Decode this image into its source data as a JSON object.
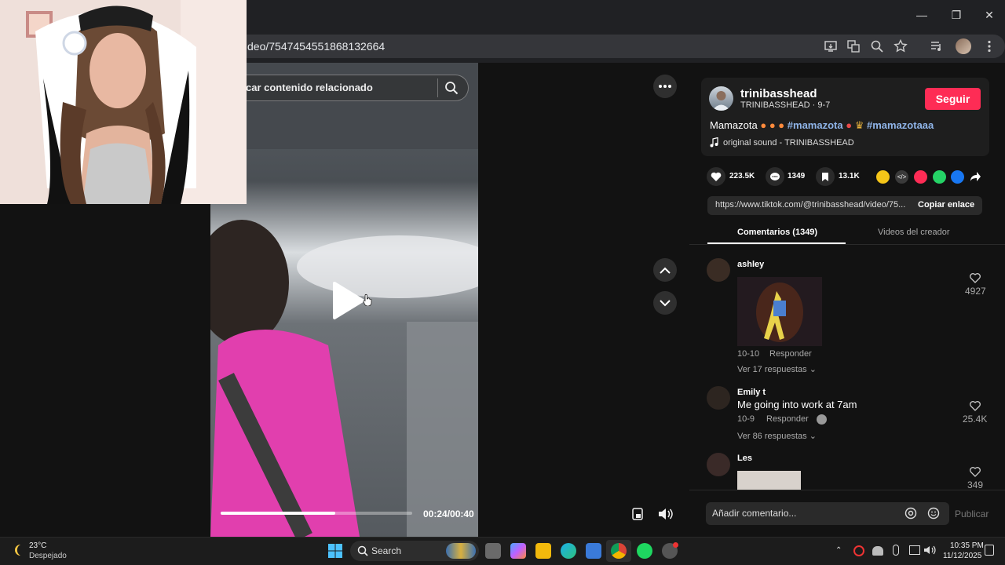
{
  "browser": {
    "url_fragment": "deo/7547454551868132664",
    "window_controls": [
      "minimize-icon",
      "maximize-icon",
      "close-icon"
    ]
  },
  "video": {
    "search_placeholder": "car contenido relacionado",
    "current_time": "00:24",
    "duration": "00:40",
    "time_display": "00:24/00:40",
    "progress_fraction": 0.6
  },
  "creator": {
    "username": "trinibasshead",
    "handle_date": "TRINIBASSHEAD · 9-7",
    "follow_label": "Seguir",
    "caption_text": "Mamazota",
    "hashtag1": "#mamazota",
    "hashtag2": "#mamazotaaa",
    "sound": "original sound - TRINIBASSHEAD"
  },
  "stats": {
    "likes": "223.5K",
    "comments": "1349",
    "saves": "13.1K"
  },
  "share": {
    "link": "https://www.tiktok.com/@trinibasshead/video/75...",
    "copy_label": "Copiar enlace"
  },
  "tabs": {
    "comments": "Comentarios (1349)",
    "creator_videos": "Videos del creador"
  },
  "comments": [
    {
      "user": "ashley",
      "text": "",
      "date": "10-10",
      "reply": "Responder",
      "likes": "4927",
      "replies": "Ver 17 respuestas"
    },
    {
      "user": "Emily t",
      "text": "Me going into work at 7am",
      "date": "10-9",
      "reply": "Responder",
      "likes": "25.4K",
      "replies": "Ver 86 respuestas"
    },
    {
      "user": "Les",
      "text": "",
      "likes": "349"
    }
  ],
  "comment_box": {
    "placeholder": "Añadir comentario...",
    "publish": "Publicar"
  },
  "taskbar": {
    "weather_temp": "23°C",
    "weather_desc": "Despejado",
    "search_label": "Search",
    "time": "10:35 PM",
    "date": "11/12/2025"
  },
  "colors": {
    "accent": "#fe2c55",
    "hashtag": "#8fb4e8",
    "panel_bg": "#121212"
  }
}
